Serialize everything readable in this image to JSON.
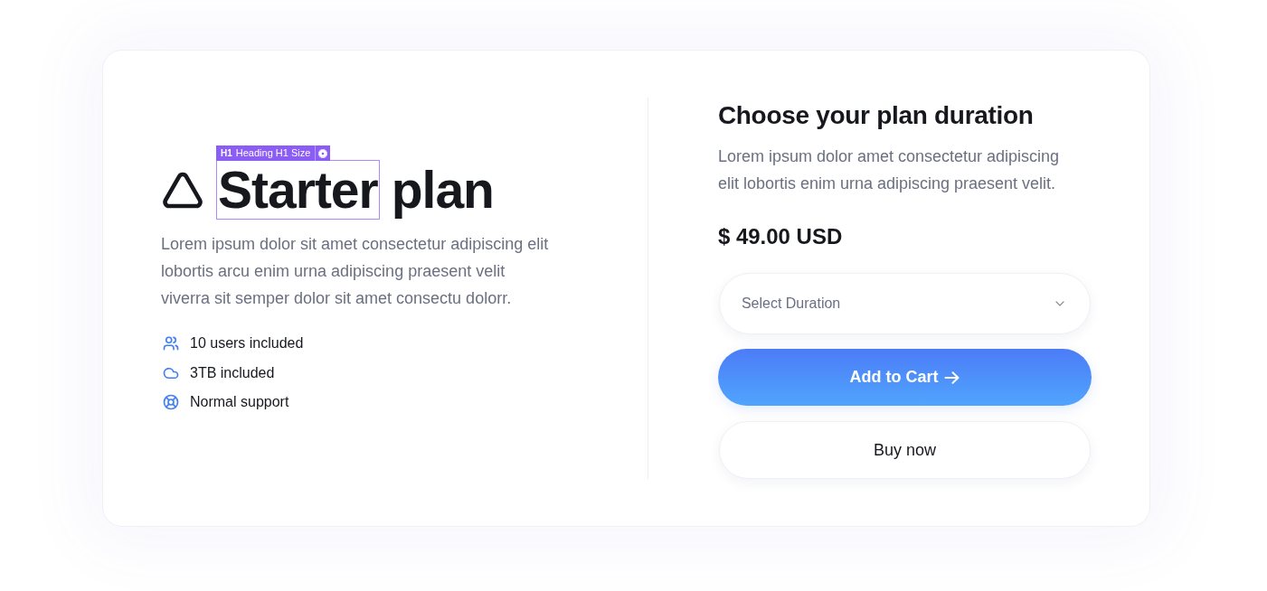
{
  "plan": {
    "title_words": [
      {
        "text": "Starter",
        "selected": true
      },
      {
        "text": "plan",
        "selected": false
      }
    ],
    "editor_badge": {
      "tag": "H1",
      "label": "Heading H1 Size"
    },
    "description": "Lorem ipsum dolor sit amet consectetur adipiscing elit lobortis arcu enim urna adipiscing praesent velit viverra sit semper dolor sit amet consectu dolorr.",
    "features": [
      {
        "kind": "users",
        "text": "10 users included"
      },
      {
        "kind": "cloud",
        "text": "3TB included"
      },
      {
        "kind": "support",
        "text": "Normal support"
      }
    ]
  },
  "checkout": {
    "title": "Choose your plan duration",
    "description": "Lorem ipsum dolor amet consectetur adipiscing elit lobortis enim urna adipiscing praesent velit.",
    "price": "$ 49.00 USD",
    "duration_select": {
      "placeholder": "Select Duration"
    },
    "buttons": [
      {
        "kind": "primary",
        "label": "Add to Cart"
      },
      {
        "kind": "secondary",
        "label": "Buy now"
      }
    ]
  }
}
